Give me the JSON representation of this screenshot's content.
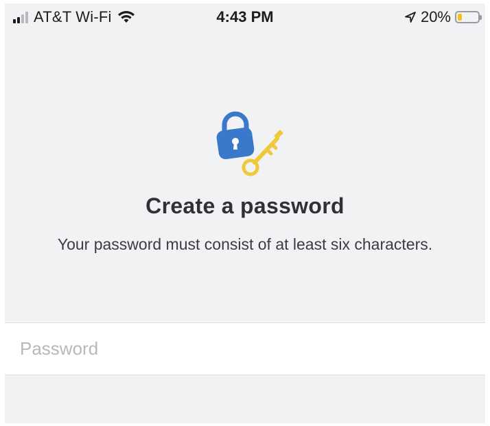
{
  "status_bar": {
    "carrier": "AT&T Wi-Fi",
    "time": "4:43 PM",
    "battery_percent": "20%",
    "battery_level": 0.2,
    "battery_color": "#f0c419"
  },
  "illustration": {
    "icon": "lock-and-key-icon",
    "lock_color": "#3a79c9",
    "key_color": "#f0c83a"
  },
  "title": "Create a password",
  "subtitle": "Your password must consist of at least six characters.",
  "password_field": {
    "value": "",
    "placeholder": "Password"
  }
}
